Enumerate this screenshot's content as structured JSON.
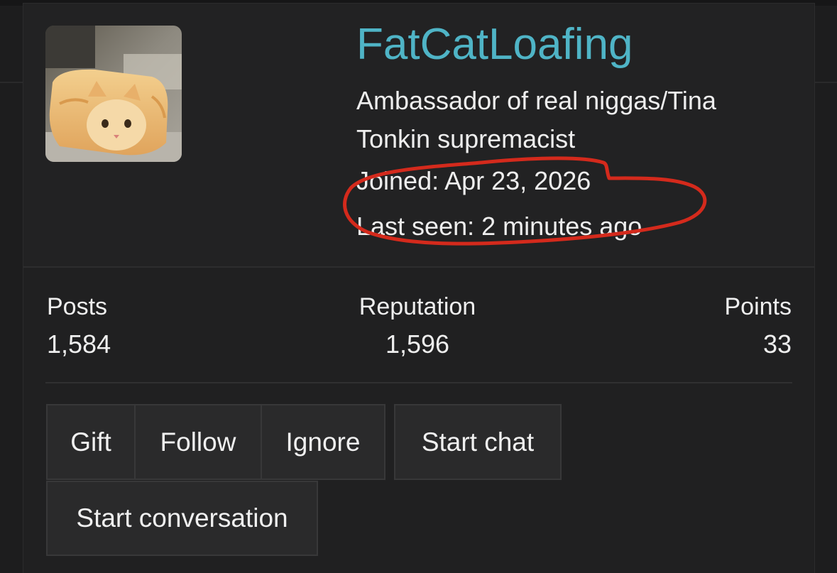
{
  "profile": {
    "username": "FatCatLoafing",
    "user_title": "Ambassador of real niggas/Tina Tonkin supremacist",
    "joined_label": "Joined:",
    "joined_date": "Apr 23, 2026",
    "last_seen_label": "Last seen:",
    "last_seen_value": "2 minutes ago",
    "avatar_icon": "cat-loaf-avatar"
  },
  "stats": {
    "posts_label": "Posts",
    "posts_value": "1,584",
    "reputation_label": "Reputation",
    "reputation_value": "1,596",
    "points_label": "Points",
    "points_value": "33"
  },
  "actions": {
    "gift": "Gift",
    "follow": "Follow",
    "ignore": "Ignore",
    "start_chat": "Start chat",
    "start_conversation": "Start conversation"
  },
  "colors": {
    "username": "#4fb4c6",
    "annotation": "#d42a1c",
    "background": "#202021"
  }
}
